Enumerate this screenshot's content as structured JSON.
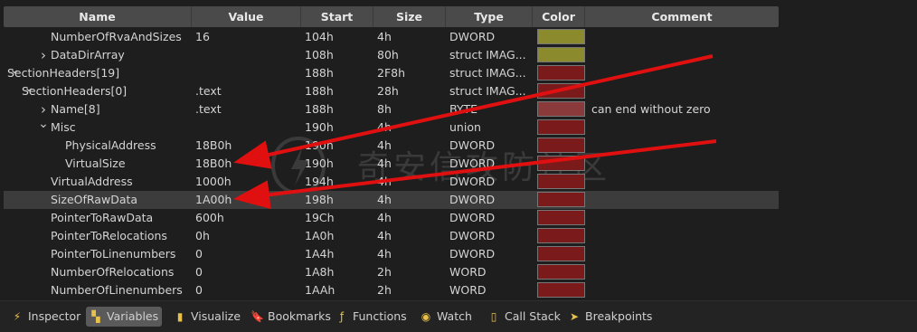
{
  "columns": {
    "name": "Name",
    "value": "Value",
    "start": "Start",
    "size": "Size",
    "type": "Type",
    "color": "Color",
    "comment": "Comment"
  },
  "rows": [
    {
      "name": "NumberOfRvaAndSizes",
      "value": "16",
      "start": "104h",
      "size": "4h",
      "type": "DWORD",
      "color": "#8b8b2e",
      "comment": ""
    },
    {
      "name": "DataDirArray",
      "value": "",
      "start": "108h",
      "size": "80h",
      "type": "struct IMAG...",
      "color": "#8b8b2e",
      "comment": ""
    },
    {
      "name": "SectionHeaders[19]",
      "value": "",
      "start": "188h",
      "size": "2F8h",
      "type": "struct IMAG...",
      "color": "#7a1a1a",
      "comment": ""
    },
    {
      "name": "SectionHeaders[0]",
      "value": ".text",
      "start": "188h",
      "size": "28h",
      "type": "struct IMAG...",
      "color": "#7a1a1a",
      "comment": ""
    },
    {
      "name": "Name[8]",
      "value": ".text",
      "start": "188h",
      "size": "8h",
      "type": "BYTE",
      "color": "#8a3a3a",
      "comment": "can end without zero"
    },
    {
      "name": "Misc",
      "value": "",
      "start": "190h",
      "size": "4h",
      "type": "union",
      "color": "#7a1a1a",
      "comment": ""
    },
    {
      "name": "PhysicalAddress",
      "value": "18B0h",
      "start": "190h",
      "size": "4h",
      "type": "DWORD",
      "color": "#7a1a1a",
      "comment": ""
    },
    {
      "name": "VirtualSize",
      "value": "18B0h",
      "start": "190h",
      "size": "4h",
      "type": "DWORD",
      "color": "#7a1a1a",
      "comment": ""
    },
    {
      "name": "VirtualAddress",
      "value": "1000h",
      "start": "194h",
      "size": "4h",
      "type": "DWORD",
      "color": "#7a1a1a",
      "comment": ""
    },
    {
      "name": "SizeOfRawData",
      "value": "1A00h",
      "start": "198h",
      "size": "4h",
      "type": "DWORD",
      "color": "#7a1a1a",
      "comment": ""
    },
    {
      "name": "PointerToRawData",
      "value": "600h",
      "start": "19Ch",
      "size": "4h",
      "type": "DWORD",
      "color": "#7a1a1a",
      "comment": ""
    },
    {
      "name": "PointerToRelocations",
      "value": "0h",
      "start": "1A0h",
      "size": "4h",
      "type": "DWORD",
      "color": "#7a1a1a",
      "comment": ""
    },
    {
      "name": "PointerToLinenumbers",
      "value": "0",
      "start": "1A4h",
      "size": "4h",
      "type": "DWORD",
      "color": "#7a1a1a",
      "comment": ""
    },
    {
      "name": "NumberOfRelocations",
      "value": "0",
      "start": "1A8h",
      "size": "2h",
      "type": "WORD",
      "color": "#7a1a1a",
      "comment": ""
    },
    {
      "name": "NumberOfLinenumbers",
      "value": "0",
      "start": "1AAh",
      "size": "2h",
      "type": "WORD",
      "color": "#7a1a1a",
      "comment": ""
    }
  ],
  "tabs": [
    {
      "label": "Inspector",
      "icon": "lightning-icon"
    },
    {
      "label": "Variables",
      "icon": "variables-icon"
    },
    {
      "label": "Visualize",
      "icon": "visualize-icon"
    },
    {
      "label": "Bookmarks",
      "icon": "bookmark-icon"
    },
    {
      "label": "Functions",
      "icon": "function-icon"
    },
    {
      "label": "Watch",
      "icon": "eye-icon"
    },
    {
      "label": "Call Stack",
      "icon": "callstack-icon"
    },
    {
      "label": "Breakpoints",
      "icon": "breakpoint-icon"
    }
  ],
  "annotation_color": "#e01010",
  "watermark": "奇安信攻防社区"
}
